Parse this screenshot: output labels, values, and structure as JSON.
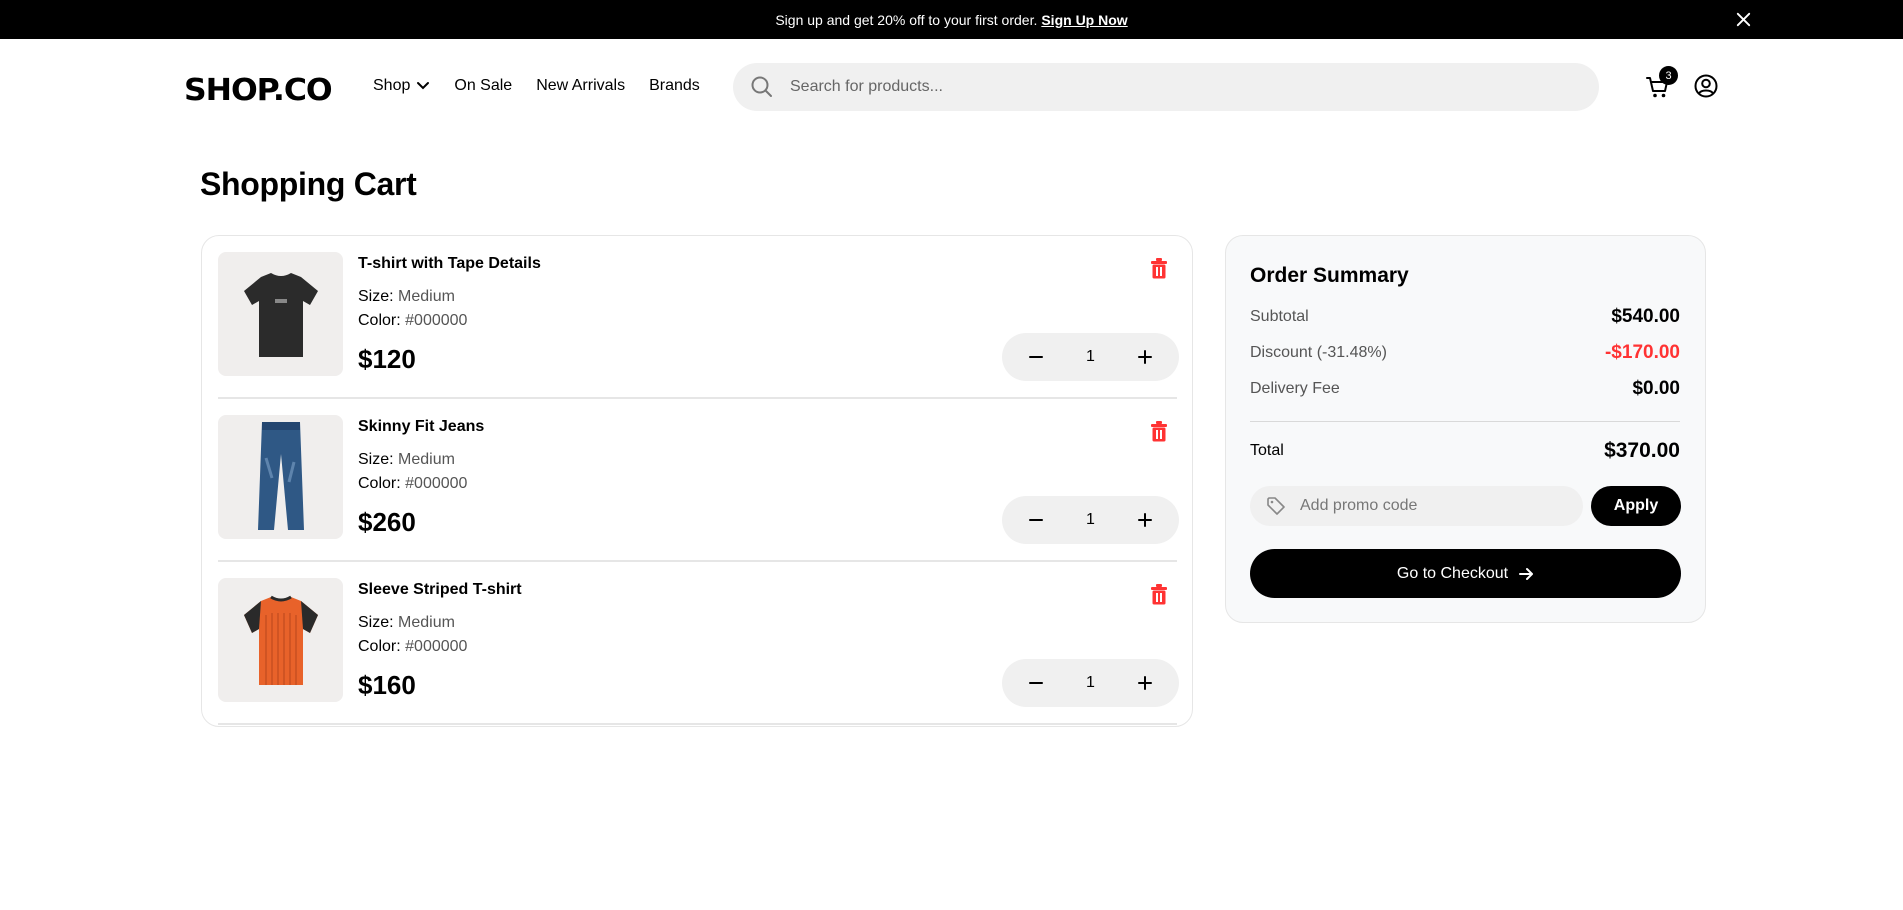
{
  "banner": {
    "text": "Sign up and get 20% off to your first order.",
    "link_label": "Sign Up Now"
  },
  "header": {
    "logo": "SHOP.CO",
    "nav": [
      {
        "label": "Shop",
        "has_dropdown": true
      },
      {
        "label": "On Sale"
      },
      {
        "label": "New Arrivals"
      },
      {
        "label": "Brands"
      }
    ],
    "search_placeholder": "Search for products...",
    "cart_count": "3"
  },
  "page": {
    "title": "Shopping Cart"
  },
  "labels": {
    "size": "Size:",
    "color": "Color:"
  },
  "cart": {
    "items": [
      {
        "name": "T-shirt with Tape Details",
        "size": "Medium",
        "color": "#000000",
        "price": "$120",
        "quantity": "1",
        "image": "black-tshirt"
      },
      {
        "name": "Skinny Fit Jeans",
        "size": "Medium",
        "color": "#000000",
        "price": "$260",
        "quantity": "1",
        "image": "blue-jeans"
      },
      {
        "name": "Sleeve Striped T-shirt",
        "size": "Medium",
        "color": "#000000",
        "price": "$160",
        "quantity": "1",
        "image": "orange-striped-tshirt"
      }
    ]
  },
  "summary": {
    "title": "Order Summary",
    "subtotal_label": "Subtotal",
    "subtotal_value": "$540.00",
    "discount_label": "Discount (-31.48%)",
    "discount_value": "-$170.00",
    "delivery_label": "Delivery Fee",
    "delivery_value": "$0.00",
    "total_label": "Total",
    "total_value": "$370.00",
    "promo_placeholder": "Add promo code",
    "apply_label": "Apply",
    "checkout_label": "Go to Checkout"
  },
  "colors": {
    "accent": "#000000",
    "discount": "#ff3333",
    "trash": "#ff3333",
    "banner_bg": "#000000"
  }
}
